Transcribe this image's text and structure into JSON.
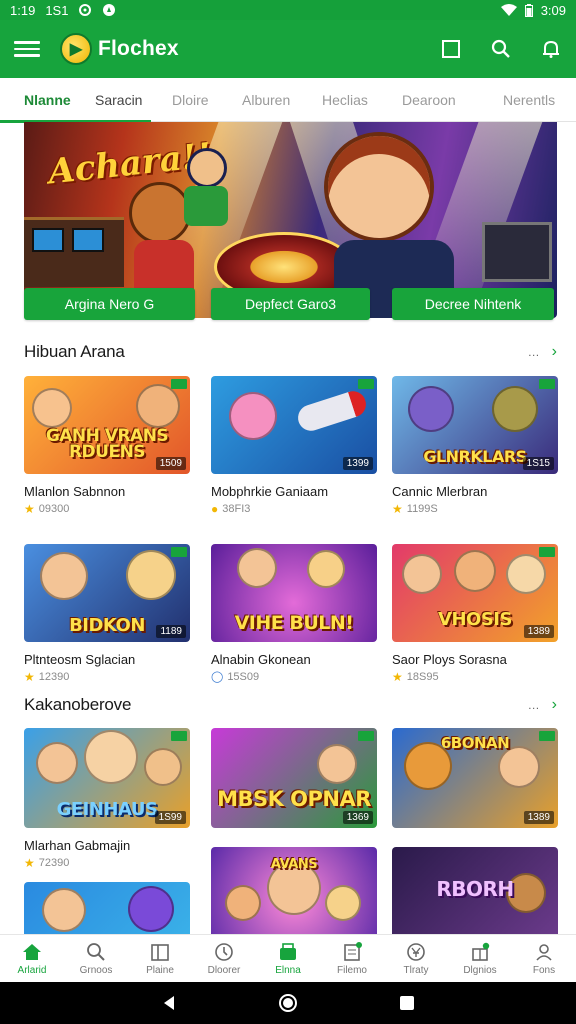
{
  "status_bar": {
    "time_left": "1:19",
    "network_left": "1S1",
    "time_right": "3:09"
  },
  "app_bar": {
    "title": "Flochex"
  },
  "tabs": [
    {
      "label": "Nlanne",
      "active": true
    },
    {
      "label": "Saracin",
      "active": false
    },
    {
      "label": "Dloire",
      "active": false
    },
    {
      "label": "Alburen",
      "active": false
    },
    {
      "label": "Heclias",
      "active": false
    },
    {
      "label": "Dearoon",
      "active": false
    },
    {
      "label": "Nerentls",
      "active": false
    }
  ],
  "hero": {
    "headline": "Achara!!",
    "buttons": [
      "Argina Nero G",
      "Depfect Garo3",
      "Decree Nihtenk"
    ]
  },
  "sections": [
    {
      "title": "Hibuan Arana",
      "more": "›"
    },
    {
      "title": "Kakanoberove",
      "more": "›"
    }
  ],
  "section1_cards": [
    {
      "name": "Mlanlon Sabnnon",
      "rating": "09300",
      "tag": "1509",
      "art": "GANH VRANS RDUENS"
    },
    {
      "name": "Mobphrkie Ganiaam",
      "rating": "38FI3",
      "tag": "1399",
      "art": ""
    },
    {
      "name": "Cannic Mlerbran",
      "rating": "1199S",
      "tag": "1S15",
      "art": "GLNRKLARS"
    },
    {
      "name": "Pltnteosm Sglacian",
      "rating": "12390",
      "tag": "1189",
      "art": "BIDKON"
    },
    {
      "name": "Alnabin Gkonean",
      "rating": "15S09",
      "tag": "",
      "art": "VIHE BULN!"
    },
    {
      "name": "Saor Ploys Sorasna",
      "rating": "18S95",
      "tag": "1389",
      "art": "VHOSIS"
    }
  ],
  "section2_cards": [
    {
      "name": "Mlarhan Gabmajin",
      "rating": "72390",
      "tag": "1S99",
      "art": "GEINHAUS"
    },
    {
      "name": "",
      "rating": "",
      "tag": "1369",
      "art": "MBSK OPNAR"
    },
    {
      "name": "",
      "rating": "",
      "tag": "1389",
      "art": "6BONAN"
    },
    {
      "name": "",
      "rating": "",
      "tag": "",
      "art": ""
    },
    {
      "name": "",
      "rating": "",
      "tag": "",
      "art": "AVANS"
    },
    {
      "name": "",
      "rating": "",
      "tag": "",
      "art": "RBORH"
    }
  ],
  "bottom_nav": [
    {
      "label": "Arlarid",
      "icon": "home-icon",
      "active": true
    },
    {
      "label": "Grnoos",
      "icon": "search-icon",
      "active": false
    },
    {
      "label": "Plaine",
      "icon": "library-icon",
      "active": false
    },
    {
      "label": "Dloorer",
      "icon": "clock-icon",
      "active": false
    },
    {
      "label": "Elnna",
      "icon": "store-icon",
      "active": false
    },
    {
      "label": "Filemo",
      "icon": "document-icon",
      "active": false
    },
    {
      "label": "Tlraty",
      "icon": "currency-icon",
      "active": false
    },
    {
      "label": "Dlgnios",
      "icon": "gift-icon",
      "active": false
    },
    {
      "label": "Fons",
      "icon": "profile-icon",
      "active": false
    }
  ],
  "colors": {
    "brand_green": "#17a43d",
    "accent_yellow": "#f2b705"
  }
}
